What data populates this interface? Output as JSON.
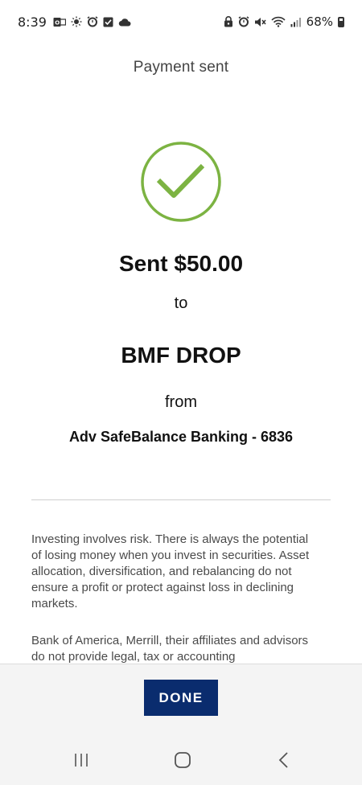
{
  "status_bar": {
    "time": "8:39",
    "battery": "68%",
    "left_icons": [
      "notification-outlook-icon",
      "sun-icon",
      "alarm-icon",
      "check-task-icon",
      "cloud-icon"
    ],
    "right_icons": [
      "lock-icon",
      "alarm-icon",
      "mute-icon",
      "wifi-icon",
      "signal-icon"
    ]
  },
  "header": {
    "title": "Payment sent"
  },
  "confirmation": {
    "icon": "check-circle-icon",
    "icon_color": "#7cb342",
    "sent_amount": "Sent $50.00",
    "to_label": "to",
    "recipient": "BMF DROP",
    "from_label": "from",
    "account": "Adv SafeBalance Banking - 6836"
  },
  "disclaimers": [
    "Investing involves risk. There is always the potential of losing money when you invest in securities. Asset allocation, diversification, and rebalancing do not ensure a profit or protect against loss in declining markets.",
    "Bank of America, Merrill, their affiliates and advisors do not provide legal, tax or accounting"
  ],
  "footer": {
    "done_label": "DONE",
    "done_color": "#0a2c6e"
  },
  "nav": {
    "recents_icon": "recent-apps-icon",
    "home_icon": "home-icon",
    "back_icon": "back-icon"
  }
}
